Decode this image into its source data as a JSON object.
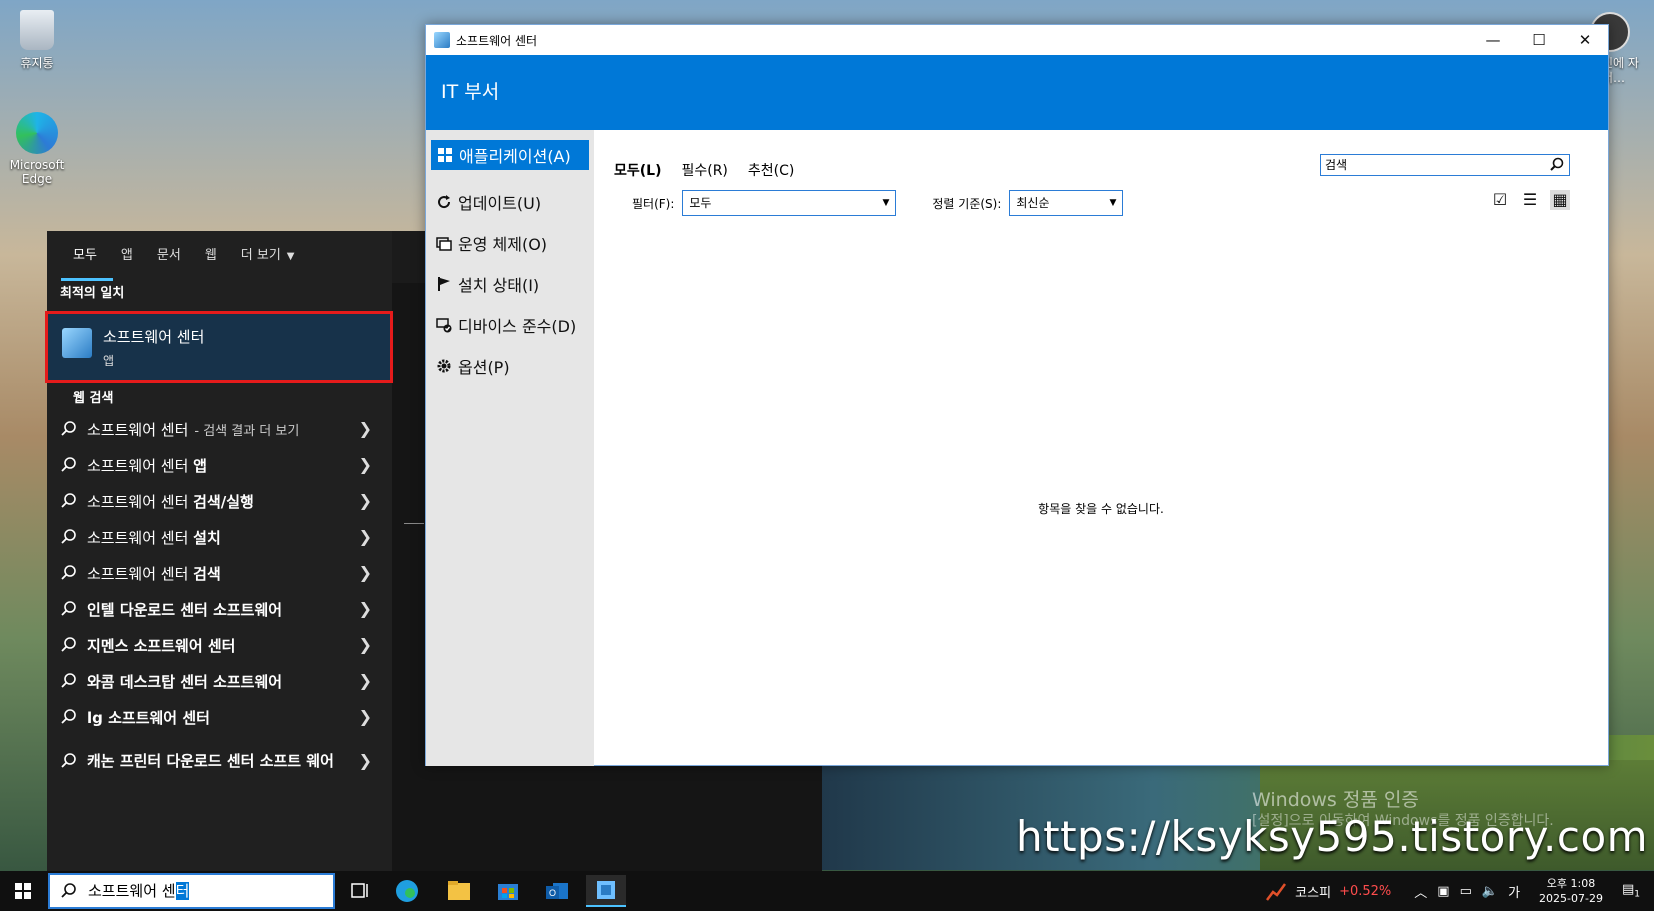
{
  "desktop": {
    "recycle_bin": "휴지통",
    "edge_label": "Microsoft Edge",
    "top_right_label": "진에 자서…"
  },
  "start_search": {
    "tabs": [
      {
        "label": "모두",
        "active": true
      },
      {
        "label": "앱"
      },
      {
        "label": "문서"
      },
      {
        "label": "웹"
      },
      {
        "label": "더 보기"
      }
    ],
    "best_match_title": "최적의 일치",
    "best_match": {
      "name": "소프트웨어 센터",
      "type": "앱"
    },
    "web_search_title": "웹 검색",
    "results": [
      {
        "text": "소프트웨어 센터",
        "suffix": "- 검색 결과 더 보기"
      },
      {
        "text": "소프트웨어 센터",
        "bold": "앱"
      },
      {
        "text": "소프트웨어 센터",
        "bold": "검색/실행"
      },
      {
        "text": "소프트웨어 센터",
        "bold": "설치"
      },
      {
        "text": "소프트웨어 센터",
        "bold": "검색"
      },
      {
        "text": "인텔 다운로드 센터 소프트웨어"
      },
      {
        "text": "지멘스 소프트웨어 센터"
      },
      {
        "text": "와콤 데스크탑 센터 소프트웨어"
      },
      {
        "text": "lg 소프트웨어 센터"
      },
      {
        "text": "캐논 프린터 다운로드 센터 소프트 웨어"
      }
    ]
  },
  "window": {
    "title": "소프트웨어 센터",
    "controls": {
      "minimize": "—",
      "maximize": "☐",
      "close": "✕"
    },
    "org": "IT 부서",
    "nav": [
      {
        "label": "애플리케이션(A)",
        "icon": "grid-icon",
        "active": true
      },
      {
        "label": "업데이트(U)",
        "icon": "refresh-icon"
      },
      {
        "label": "운영 체제(O)",
        "icon": "windows-icon"
      },
      {
        "label": "설치 상태(I)",
        "icon": "flag-icon"
      },
      {
        "label": "디바이스 준수(D)",
        "icon": "device-check-icon"
      },
      {
        "label": "옵션(P)",
        "icon": "gear-icon"
      }
    ],
    "filter_tabs": [
      {
        "label": "모두(L)",
        "active": true
      },
      {
        "label": "필수(R)"
      },
      {
        "label": "추천(C)"
      }
    ],
    "filter_label": "필터(F):",
    "filter_value": "모두",
    "sort_label": "정렬 기준(S):",
    "sort_value": "최신순",
    "search_placeholder": "검색",
    "empty_message": "항목을 찾을 수 없습니다."
  },
  "watermark": {
    "line1": "Windows 정품 인증",
    "line2": "[설정]으로 이동하여 Windows를 정품 인증합니다.",
    "url": "https://ksyksy595.tistory.com"
  },
  "taskbar": {
    "search_value_prefix": "소프트웨어 센",
    "search_value_selected": "터",
    "kospi_label": "코스피",
    "kospi_change": "+0.52%",
    "ime": "가",
    "time": "오후 1:08",
    "date": "2025-07-29",
    "notification_count": "1"
  },
  "colors": {
    "accent": "#0078d7",
    "highlight_border": "#e51b1b",
    "kospi": "#ff4d4d"
  }
}
